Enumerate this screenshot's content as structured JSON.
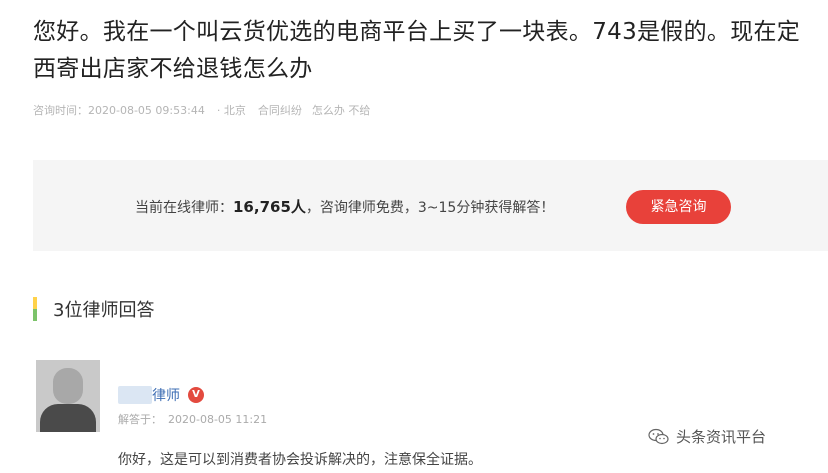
{
  "question": {
    "title": "您好。我在一个叫云货优选的电商平台上买了一块表。743是假的。现在定西寄出店家不给退钱怎么办",
    "meta": {
      "time_label": "咨询时间：2020-08-05 09:53:44",
      "location": "· 北京",
      "tags": [
        "合同纠纷",
        "怎么办 不给"
      ]
    }
  },
  "banner": {
    "prefix": "当前在线律师：",
    "count": "16,765人",
    "suffix": "，咨询律师免费，3~15分钟获得解答！",
    "button_label": "紧急咨询",
    "accent_color": "#e8413a"
  },
  "answers_section": {
    "title": "3位律师回答"
  },
  "answer": {
    "lawyer_name": "律师",
    "badge": "V",
    "meta_label": "解答于：",
    "meta_time": "2020-08-05 11:21",
    "text": "你好，这是可以到消费者协会投诉解决的，注意保全证据。"
  },
  "watermark": {
    "text": "头条资讯平台",
    "icon": "wechat-icon"
  }
}
